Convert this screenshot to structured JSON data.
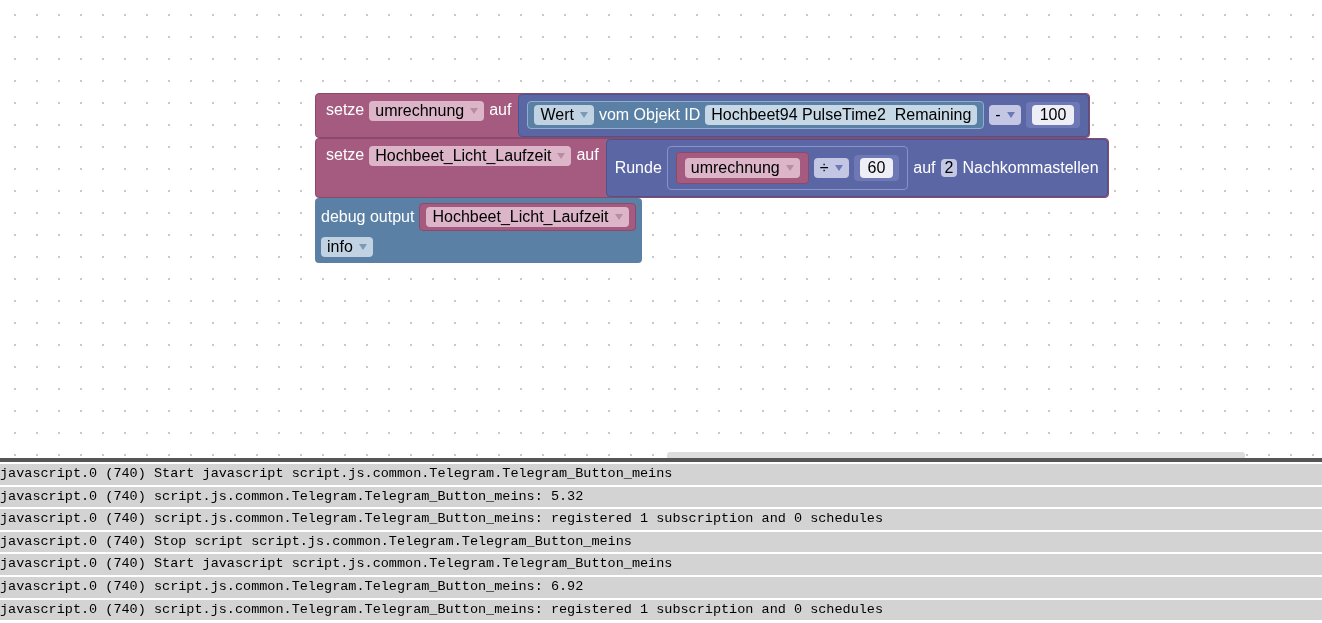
{
  "workspace": {
    "blocks": [
      {
        "kind": "set",
        "rows": [
          [
            {
              "kind": "label",
              "text": "setze"
            },
            {
              "kind": "dropdown",
              "text": "umrechnung"
            },
            {
              "kind": "label",
              "text": "auf"
            },
            {
              "kind": "block",
              "block": {
                "kind": "math",
                "rows": [
                  [
                    {
                      "kind": "block",
                      "block": {
                        "kind": "getvalue",
                        "rows": [
                          [
                            {
                              "kind": "dropdown",
                              "text": "Wert"
                            },
                            {
                              "kind": "label",
                              "text": "vom Objekt ID"
                            },
                            {
                              "kind": "field",
                              "text": "Hochbeet94 PulseTime2  Remaining"
                            }
                          ]
                        ]
                      }
                    },
                    {
                      "kind": "dropdown",
                      "text": "-"
                    },
                    {
                      "kind": "block",
                      "block": {
                        "kind": "number",
                        "rows": [
                          [
                            {
                              "kind": "field",
                              "text": "100"
                            }
                          ]
                        ]
                      }
                    }
                  ]
                ]
              }
            }
          ]
        ]
      },
      {
        "kind": "set",
        "rows": [
          [
            {
              "kind": "label",
              "text": "setze"
            },
            {
              "kind": "dropdown",
              "text": "Hochbeet_Licht_Laufzeit"
            },
            {
              "kind": "label",
              "text": "auf"
            },
            {
              "kind": "block",
              "block": {
                "kind": "math",
                "rows": [
                  [
                    {
                      "kind": "label",
                      "text": "Runde"
                    },
                    {
                      "kind": "block",
                      "block": {
                        "kind": "math",
                        "rows": [
                          [
                            {
                              "kind": "block",
                              "block": {
                                "kind": "variable",
                                "rows": [
                                  [
                                    {
                                      "kind": "dropdown",
                                      "text": "umrechnung"
                                    }
                                  ]
                                ]
                              }
                            },
                            {
                              "kind": "dropdown",
                              "text": "÷"
                            },
                            {
                              "kind": "block",
                              "block": {
                                "kind": "number",
                                "rows": [
                                  [
                                    {
                                      "kind": "field",
                                      "text": "60"
                                    }
                                  ]
                                ]
                              }
                            }
                          ]
                        ]
                      }
                    },
                    {
                      "kind": "label",
                      "text": "auf"
                    },
                    {
                      "kind": "field",
                      "text": "2"
                    },
                    {
                      "kind": "label",
                      "text": "Nachkommastellen"
                    }
                  ]
                ]
              }
            }
          ]
        ]
      },
      {
        "kind": "debug",
        "rows": [
          [
            {
              "kind": "label",
              "text": "debug output"
            },
            {
              "kind": "block",
              "block": {
                "kind": "variable",
                "rows": [
                  [
                    {
                      "kind": "dropdown",
                      "text": "Hochbeet_Licht_Laufzeit"
                    }
                  ]
                ]
              }
            }
          ],
          [
            {
              "kind": "dropdown",
              "text": "info"
            }
          ]
        ]
      }
    ]
  },
  "log": {
    "lines": [
      "javascript.0 (740) Start javascript script.js.common.Telegram.Telegram_Button_meins",
      "javascript.0 (740) script.js.common.Telegram.Telegram_Button_meins: 5.32",
      "javascript.0 (740) script.js.common.Telegram.Telegram_Button_meins: registered 1 subscription and 0 schedules",
      "javascript.0 (740) Stop script script.js.common.Telegram.Telegram_Button_meins",
      "javascript.0 (740) Start javascript script.js.common.Telegram.Telegram_Button_meins",
      "javascript.0 (740) script.js.common.Telegram.Telegram_Button_meins: 6.92",
      "javascript.0 (740) script.js.common.Telegram.Telegram_Button_meins: registered 1 subscription and 0 schedules"
    ]
  }
}
